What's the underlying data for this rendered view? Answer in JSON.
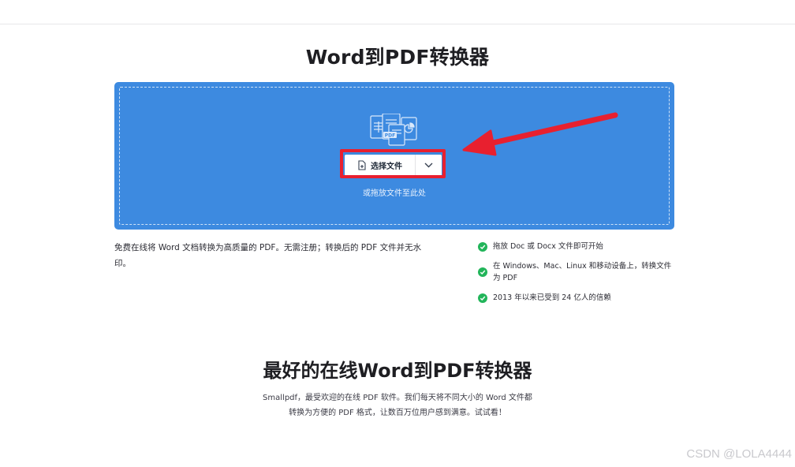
{
  "page": {
    "title": "Word到PDF转换器"
  },
  "upload": {
    "button_label": "选择文件",
    "drop_hint": "或拖放文件至此处",
    "illustration_label": "PDF",
    "annotation_color": "#e8202f",
    "zone_color": "#3d8ae0"
  },
  "description": "免费在线将 Word 文档转换为高质量的 PDF。无需注册；转换后的 PDF 文件并无水印。",
  "features": [
    "拖放 Doc 或 Docx 文件即可开始",
    "在 Windows、Mac、Linux 和移动设备上，转换文件为 PDF",
    "2013 年以来已受到 24 亿人的信赖"
  ],
  "section": {
    "title": "最好的在线Word到PDF转换器",
    "desc_line1": "Smallpdf，最受欢迎的在线 PDF 软件。我们每天将不同大小的 Word 文件都",
    "desc_line2": "转换为方便的 PDF 格式，让数百万位用户感到满意。试试看！"
  },
  "watermark": "CSDN @LOLA4444"
}
